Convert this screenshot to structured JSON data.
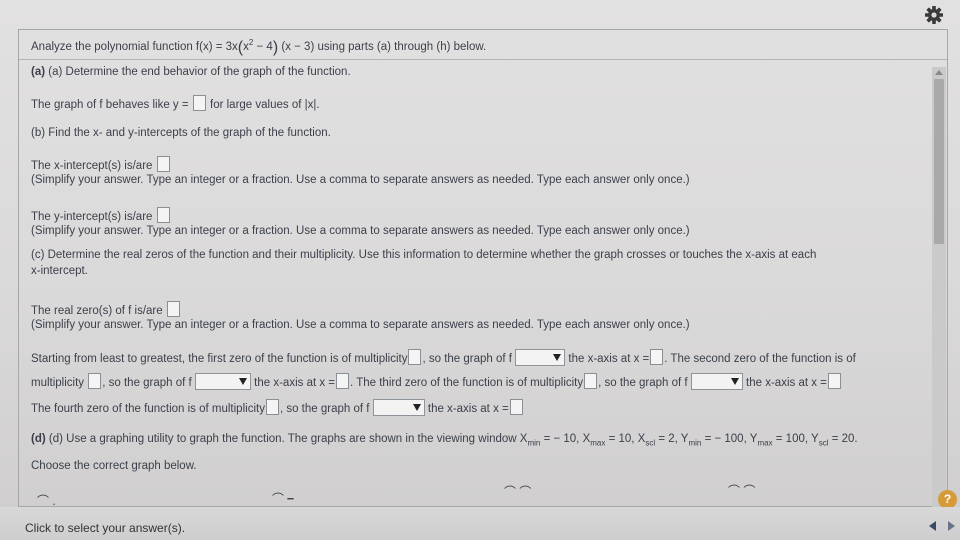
{
  "title": {
    "prefix": "Analyze the polynomial function f(x) = 3x",
    "paren_open": "(",
    "x": "x",
    "exp": "2",
    "minus4": " − 4",
    "paren_close": ")",
    "suffix": " (x − 3) using parts (a) through (h) below."
  },
  "part_a": {
    "heading": "(a) Determine the end behavior of the graph of the function.",
    "prompt_pre": "The graph of f behaves like y =",
    "prompt_post": "for large values of |x|."
  },
  "part_b": {
    "heading": "(b) Find the x- and y-intercepts of the graph of the function.",
    "x_label": "The x-intercept(s) is/are",
    "x_hint": "(Simplify your answer. Type an integer or a fraction. Use a comma to separate answers as needed. Type each answer only once.)",
    "y_label": "The y-intercept(s) is/are",
    "y_hint": "(Simplify your answer. Type an integer or a fraction. Use a comma to separate answers as needed. Type each answer only once.)"
  },
  "part_c": {
    "heading_line1": "(c) Determine the real zeros of the function and their multiplicity. Use this information to determine whether the graph crosses or touches the x-axis at each",
    "heading_line2": "x-intercept.",
    "zeros_label": "The real zero(s) of f is/are",
    "zeros_hint": "(Simplify your answer. Type an integer or a fraction. Use a comma to separate answers as needed. Type each answer only once.)",
    "s1": "Starting from least to greatest, the first zero of the function is of multiplicity",
    "s2": ", so the graph of f",
    "s3": "the x-axis at x =",
    "s4": ". The second zero of the function is of",
    "s5": "multiplicity",
    "s6": ", so the graph of f",
    "s7": "the x-axis at x =",
    "s8": ". The third zero of the function is of multiplicity",
    "s9": ", so the graph of f",
    "s10": "the x-axis at x =",
    "s11": "The fourth zero of the function is of multiplicity",
    "s12": ", so the graph of f",
    "s13": "the x-axis at x ="
  },
  "part_d": {
    "heading_pre": "(d) Use a graphing utility to graph the function. The graphs are shown in the viewing window X",
    "min": "min",
    "eq1": " = − 10, X",
    "max": "max",
    "eq2": " = 10, X",
    "scl": "scl",
    "eq3": " = 2, Y",
    "eq4": " = − 100, Y",
    "eq5": " = 100, Y",
    "eq6": " = 20.",
    "choose": "Choose the correct graph below."
  },
  "footer": {
    "status": "Click to select your answer(s).",
    "help": "?"
  },
  "icons": {
    "settings": "gear-icon",
    "help": "help-icon",
    "prev": "arrow-left-icon",
    "next": "arrow-right-icon"
  },
  "colors": {
    "help_badge": "#d69a39",
    "text": "#3c3f4a"
  }
}
